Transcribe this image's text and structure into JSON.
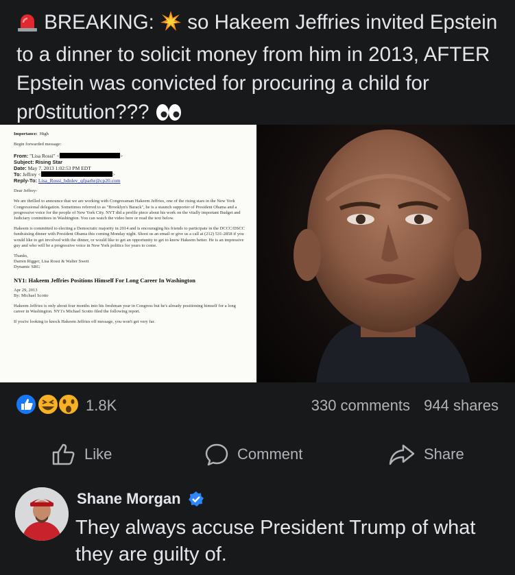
{
  "post": {
    "prefix": "BREAKING:",
    "body": "so Hakeem Jeffries invited Epstein to a dinner to solicit money from him in 2013, AFTER Epstein was convicted for procuring a child for pr0stitution???",
    "icons": [
      "siren-icon",
      "explosion-icon",
      "eyes-icon"
    ]
  },
  "document": {
    "importance_label": "Importance:",
    "importance_value": "High",
    "forwarded": "Begin forwarded message:",
    "from_label": "From:",
    "from_value": "\"Lisa Rossi\" <",
    "subject_label": "Subject:",
    "subject_value": "Rising Star",
    "date_label": "Date:",
    "date_value": "May 7, 2013 1:02:53 PM EDT",
    "to_label": "To:",
    "to_value": "Jeffrey <",
    "replyto_label": "Reply-To:",
    "replyto_value": "Lisa_Rossi_bdnlev_qfparhr@cp20.com",
    "greeting": "Dear Jeffrey-",
    "para1": "We are thrilled to announce that we are working with Congressman Hakeem Jeffries, one of the rising stars in the New York Congressional delegation. Sometimes referred to as \"Brooklyn's Barack\", he is a staunch supporter of President Obama and a progressive voice for the people of New York City. NYT did a profile piece about his work on the vitally important Budget and Judiciary committees in Washington. You can watch the video here or read the text below.",
    "para2": "Hakeem is committed to electing a Democratic majority in 2014 and is encouraging his friends to participate in the DCCC/DSCC fundraising dinner with President Obama this coming Monday night. Shoot us an email or give us a call at (212) 531-2858 if you would like to get involved with the dinner, or would like to get an opportunity to get to know Hakeem better. He is an impressive guy and who will be a progressive voice in New York politics for years to come.",
    "thanks": "Thanks,",
    "signers": "Darren Rigger, Lisa Rossi & Walter Swett",
    "org": "Dynamic SRG",
    "headline": "NY1: Hakeem Jeffries Positions Himself For Long Career In Washington",
    "article_date": "Apr 29, 2013",
    "byline": "By: Michael Scotto",
    "para3": "Hakeem Jeffries is only about four months into his freshman year in Congress but he's already positioning himself for a long career in Washington. NY1's Michael Scotto filed the following report.",
    "para4": "If you're looking to knock Hakeem Jeffries off message, you won't get very far."
  },
  "stats": {
    "reactions_count": "1.8K",
    "comments": "330 comments",
    "shares": "944 shares",
    "reaction_icons": [
      "like-reaction-icon",
      "haha-reaction-icon",
      "wow-reaction-icon"
    ]
  },
  "actions": {
    "like": "Like",
    "comment": "Comment",
    "share": "Share"
  },
  "comment": {
    "author": "Shane Morgan",
    "text": "They always accuse President Trump of what they are guilty of."
  },
  "colors": {
    "background": "#18191a",
    "text": "#e4e6eb",
    "secondary": "#b0b3b8",
    "verified": "#2d88ff"
  }
}
